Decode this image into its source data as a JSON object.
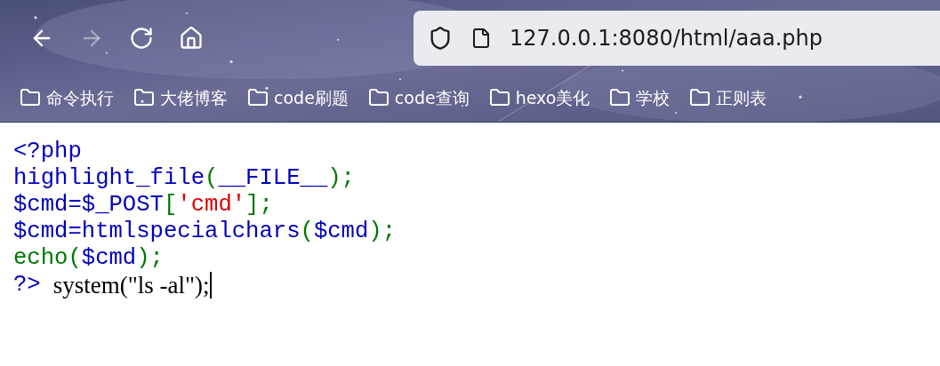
{
  "toolbar": {
    "nav_buttons": [
      {
        "kind": "back",
        "disabled": false
      },
      {
        "kind": "forward",
        "disabled": true
      },
      {
        "kind": "reload",
        "disabled": false
      },
      {
        "kind": "home",
        "disabled": false
      }
    ],
    "address": "127.0.0.1:8080/html/aaa.php"
  },
  "bookmarks": [
    "命令执行",
    "大佬博客",
    "code刷题",
    "code查询",
    "hexo美化",
    "学校",
    "正则表"
  ],
  "code_lines": [
    [
      {
        "kind": "keyword",
        "text": "<?php"
      }
    ],
    [
      {
        "kind": "keyword",
        "text": "highlight_file"
      },
      {
        "kind": "default",
        "text": "("
      },
      {
        "kind": "keyword",
        "text": "__FILE__"
      },
      {
        "kind": "default",
        "text": ");"
      }
    ],
    [
      {
        "kind": "keyword",
        "text": "$cmd=$_POST"
      },
      {
        "kind": "default",
        "text": "["
      },
      {
        "kind": "string",
        "text": "'cmd'"
      },
      {
        "kind": "default",
        "text": "];"
      }
    ],
    [
      {
        "kind": "keyword",
        "text": "$cmd=htmlspecialchars"
      },
      {
        "kind": "default",
        "text": "("
      },
      {
        "kind": "keyword",
        "text": "$cmd"
      },
      {
        "kind": "default",
        "text": ");"
      }
    ],
    [
      {
        "kind": "default",
        "text": "echo("
      },
      {
        "kind": "keyword",
        "text": "$cmd"
      },
      {
        "kind": "default",
        "text": ");"
      }
    ],
    [
      {
        "kind": "keyword",
        "text": "?>"
      },
      {
        "kind": "html",
        "text": "system(\"ls -al\");"
      }
    ]
  ]
}
